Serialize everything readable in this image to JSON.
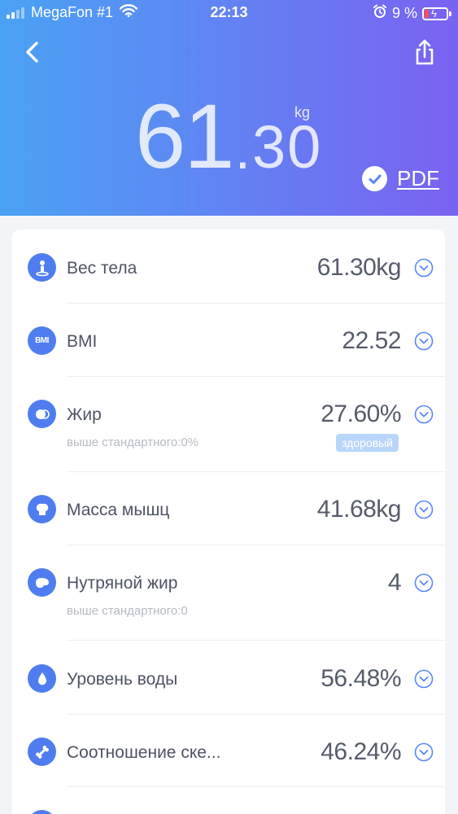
{
  "status": {
    "carrier": "MegaFon #1",
    "time": "22:13",
    "battery": "9 %"
  },
  "header": {
    "weight_int": "61",
    "weight_dot": ".",
    "weight_dec": "30",
    "unit": "kg",
    "pdf_label": "PDF"
  },
  "icons": {
    "back": "chevron-left-icon",
    "share": "share-icon",
    "pdf_check": "check-circle-icon"
  },
  "colors": {
    "gradient_start": "#4aa2f4",
    "gradient_end": "#7a62f1",
    "accent": "#4f7df0",
    "badge": "#b9d6fa"
  },
  "metrics": [
    {
      "label": "Вес тела",
      "value": "61.30kg",
      "icon": "body-weight-icon"
    },
    {
      "label": "BMI",
      "value": "22.52",
      "icon": "bmi-icon",
      "icon_text": "BMI"
    },
    {
      "label": "Жир",
      "value": "27.60%",
      "sub": "выше стандартного:0%",
      "badge": "здоровый",
      "icon": "fat-icon"
    },
    {
      "label": "Масса мышц",
      "value": "41.68kg",
      "icon": "muscle-icon"
    },
    {
      "label": "Нутряной жир",
      "value": "4",
      "sub": "выше стандартного:0",
      "icon": "visceral-fat-icon"
    },
    {
      "label": "Уровень воды",
      "value": "56.48%",
      "icon": "water-drop-icon"
    },
    {
      "label": "Соотношение ске...",
      "value": "46.24%",
      "icon": "bone-icon"
    }
  ]
}
